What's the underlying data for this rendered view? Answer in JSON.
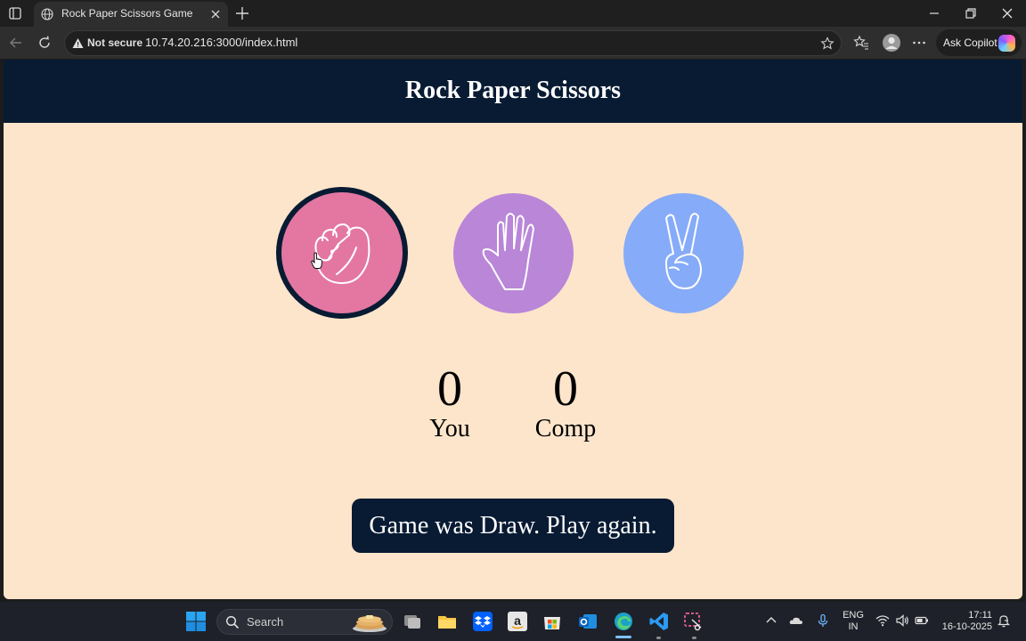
{
  "browser": {
    "tab_title": "Rock Paper Scissors Game",
    "security_label": "Not secure",
    "url": "10.74.20.216:3000/index.html",
    "copilot_label": "Ask Copilot"
  },
  "game": {
    "title": "Rock Paper Scissors",
    "choices": [
      {
        "name": "rock",
        "color": "#e377a2",
        "selected": true
      },
      {
        "name": "paper",
        "color": "#b986d8",
        "selected": false
      },
      {
        "name": "scissors",
        "color": "#86abf8",
        "selected": false
      }
    ],
    "score": {
      "user": "0",
      "user_label": "You",
      "comp": "0",
      "comp_label": "Comp"
    },
    "message": "Game was Draw. Play again.",
    "colors": {
      "header": "#081b33",
      "background": "#fde5cb",
      "message_bg": "#081b33"
    }
  },
  "taskbar": {
    "search_placeholder": "Search",
    "lang_line1": "ENG",
    "lang_line2": "IN",
    "time": "17:11",
    "date": "16-10-2025"
  }
}
